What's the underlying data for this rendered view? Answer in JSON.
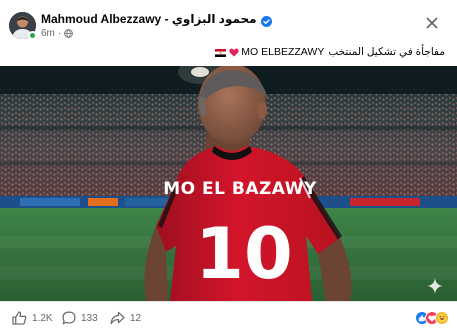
{
  "post": {
    "author_name": "Mahmoud Albezzawy - محمود البزاوي",
    "time": "6m",
    "caption_text": "مفاجأة في تشكيل المنتخب",
    "caption_name": "MO ELBEZZAWY",
    "close_icon": "close-icon",
    "verified_color": "#1877f2"
  },
  "photo": {
    "jersey_name": "MO EL BAZAWY",
    "jersey_number": "10",
    "jersey_color": "#d3152b",
    "pitch_color": "#2f6a39"
  },
  "footer": {
    "like_count": "1.2K",
    "comment_count": "133",
    "share_count": "12",
    "reactions": [
      "like-icon",
      "love-icon",
      "haha-icon"
    ]
  }
}
